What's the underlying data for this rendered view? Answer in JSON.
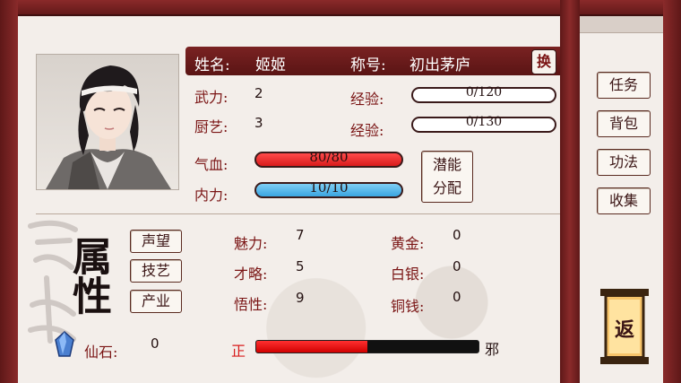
{
  "character": {
    "name_label": "姓名:",
    "name": "姬姬",
    "title_label": "称号:",
    "title": "初出茅庐",
    "swap_label": "换"
  },
  "stats": {
    "martial_label": "武力:",
    "martial": "2",
    "martial_exp_label": "经验:",
    "martial_exp": "0/120",
    "cooking_label": "厨艺:",
    "cooking": "3",
    "cooking_exp_label": "经验:",
    "cooking_exp": "0/130",
    "hp_label": "气血:",
    "hp": "80/80",
    "hp_ratio": 1.0,
    "mp_label": "内力:",
    "mp": "10/10",
    "mp_ratio": 1.0,
    "allocate_label_1": "潜能",
    "allocate_label_2": "分配"
  },
  "attributes_section": {
    "tabs": [
      "声望",
      "技艺",
      "产业"
    ],
    "charm_label": "魅力:",
    "charm": "7",
    "talent_label": "才略:",
    "talent": "5",
    "insight_label": "悟性:",
    "insight": "9",
    "gold_label": "黄金:",
    "gold": "0",
    "silver_label": "白银:",
    "silver": "0",
    "copper_label": "铜钱:",
    "copper": "0",
    "attribute_calligraphy": "属性"
  },
  "bottom": {
    "gem_label": "仙石:",
    "gem": "0",
    "righteous_label": "正",
    "evil_label": "邪",
    "alignment_ratio": 0.5
  },
  "side_menu": {
    "items": [
      "任务",
      "背包",
      "功法",
      "收集"
    ],
    "return_label": "返"
  },
  "colors": {
    "frame": "#6b1e1e",
    "name_bar": "#6a1a1a",
    "hp_fill": "#e22a2a",
    "mp_fill": "#4fb2e8",
    "panel_bg": "#f3eeea"
  }
}
